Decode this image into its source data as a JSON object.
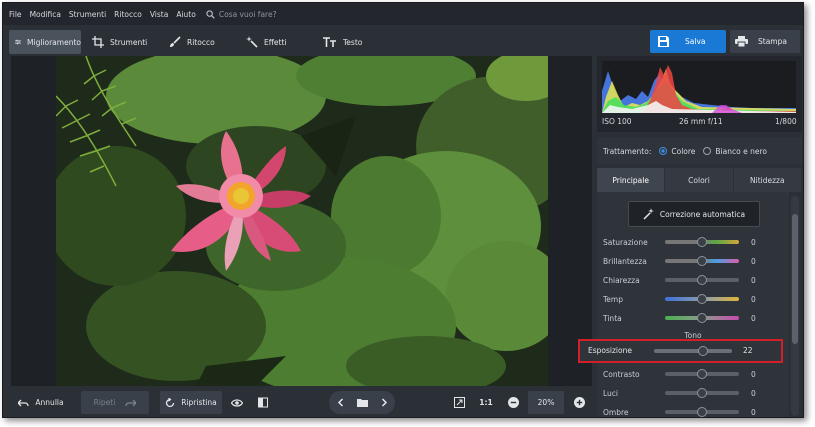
{
  "menu": {
    "items": [
      "File",
      "Modifica",
      "Strumenti",
      "Ritocco",
      "Vista",
      "Aiuto"
    ],
    "search_placeholder": "Cosa vuoi fare?"
  },
  "toolbar": {
    "tabs": [
      "Miglioramento",
      "Strumenti",
      "Ritocco",
      "Effetti",
      "Testo"
    ],
    "active_tab": "Miglioramento",
    "save_label": "Salva",
    "print_label": "Stampa",
    "accent_color": "#1b79d6"
  },
  "histogram": {
    "iso": "ISO 100",
    "lens": "26 mm f/11",
    "shutter": "1/800"
  },
  "treatment": {
    "label": "Trattamento:",
    "options": [
      "Colore",
      "Bianco e nero"
    ],
    "selected": "Colore"
  },
  "panel_tabs": {
    "items": [
      "Principale",
      "Colori",
      "Nitidezza"
    ],
    "active": "Principale"
  },
  "auto_correction_label": "Correzione automatica",
  "color_sliders": [
    {
      "label": "Saturazione",
      "value": "0"
    },
    {
      "label": "Brillantezza",
      "value": "0"
    },
    {
      "label": "Chiarezza",
      "value": "0"
    },
    {
      "label": "Temp",
      "value": "0"
    },
    {
      "label": "Tinta",
      "value": "0"
    }
  ],
  "tone_section": {
    "title": "Tono",
    "exposure": {
      "label": "Esposizione",
      "value": "22"
    },
    "sliders": [
      {
        "label": "Contrasto",
        "value": "0"
      },
      {
        "label": "Luci",
        "value": "0"
      },
      {
        "label": "Ombre",
        "value": "0"
      }
    ]
  },
  "bottom": {
    "undo_label": "Annulla",
    "redo_label": "Ripeti",
    "reset_label": "Ripristina",
    "ratio_label": "1:1",
    "zoom_value": "20%"
  },
  "highlight_color": "#d21f2a"
}
